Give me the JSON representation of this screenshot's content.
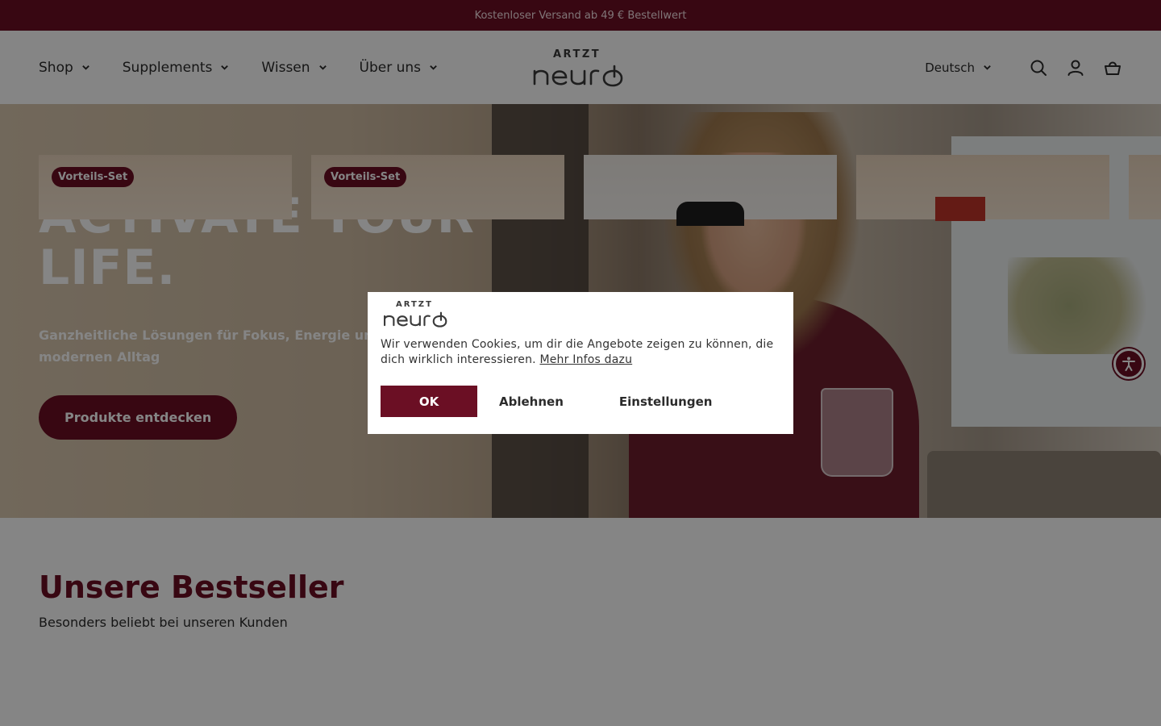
{
  "announcement": "Kostenloser Versand ab 49 € Bestellwert",
  "header": {
    "nav": [
      "Shop",
      "Supplements",
      "Wissen",
      "Über uns"
    ],
    "logo_top": "ARTZT",
    "logo_main": "neuro",
    "language": "Deutsch",
    "icons": [
      "search-icon",
      "account-icon",
      "cart-icon"
    ]
  },
  "hero": {
    "title": "ACTIVATE YOUR LIFE.",
    "subtitle": "Ganzheitliche Lösungen für Fokus, Energie und l... modernen Alltag",
    "subtitle_line1": "Ganzheitliche Lösungen für Fokus, Energie und l",
    "subtitle_line2": "modernen Alltag",
    "cta": "Produkte entdecken"
  },
  "bestsellers": {
    "title": "Unsere Bestseller",
    "subtitle": "Besonders beliebt bei unseren Kunden",
    "badges": [
      "Vorteils-Set",
      "Vorteils-Set"
    ]
  },
  "cookie": {
    "logo_top": "ARTZT",
    "logo_main": "neuro",
    "text": "Wir verwenden Cookies, um dir die Angebote zeigen zu können, die dich wirklich interessieren.",
    "link": "Mehr Infos dazu",
    "ok": "OK",
    "decline": "Ablehnen",
    "settings": "Einstellungen"
  },
  "colors": {
    "brand": "#6b0f24",
    "overlay": "rgba(0,0,0,0.48)"
  }
}
